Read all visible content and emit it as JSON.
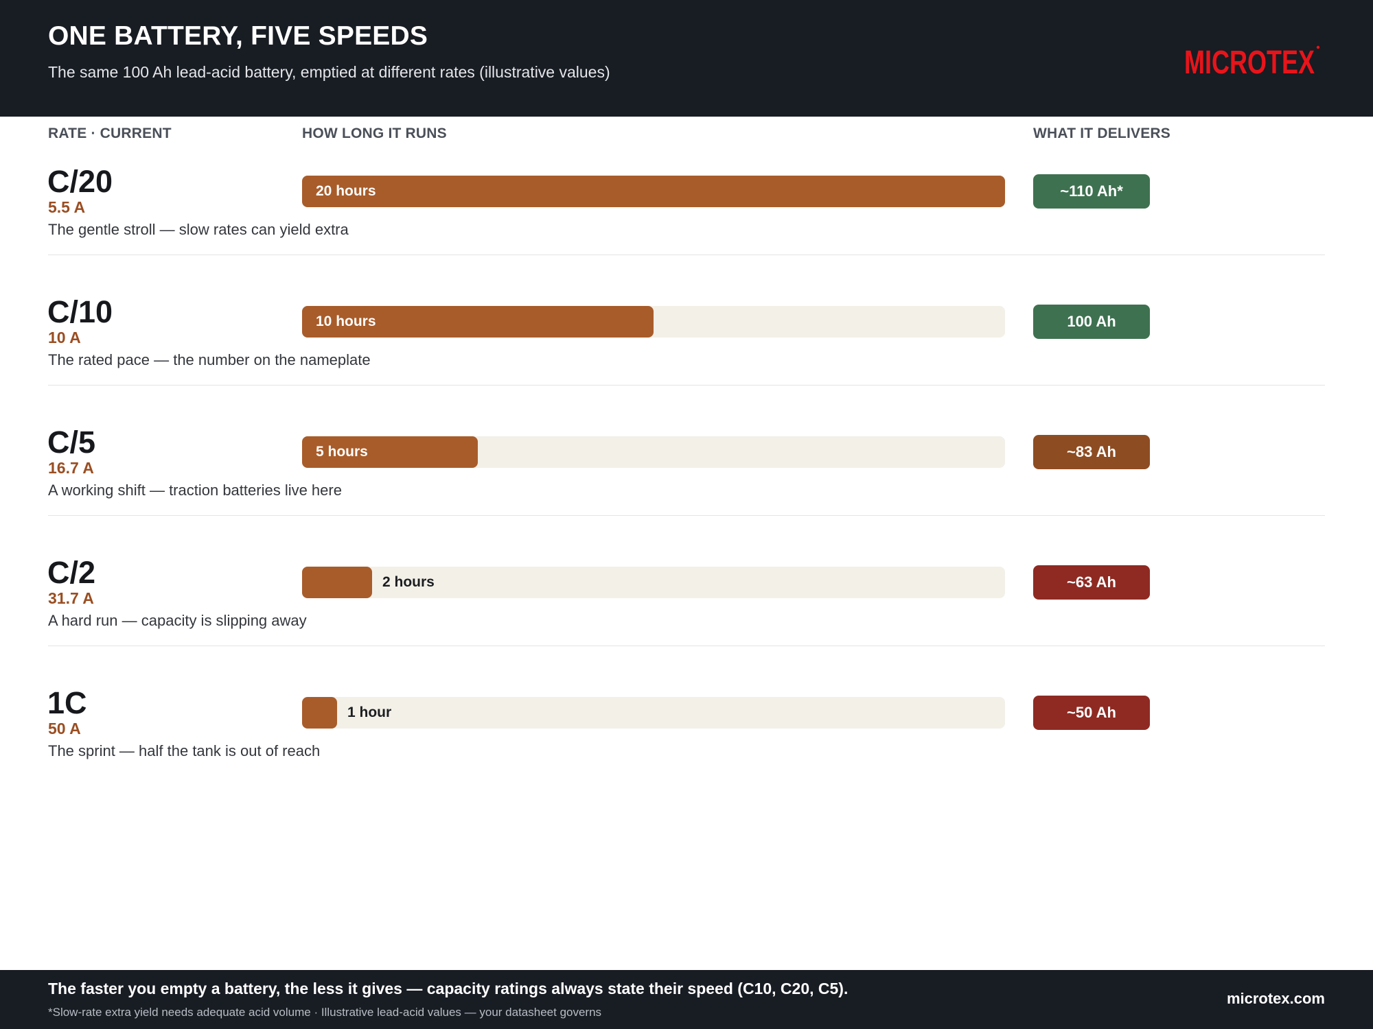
{
  "header": {
    "title": "ONE BATTERY, FIVE SPEEDS",
    "subtitle": "The same 100 Ah lead-acid battery, emptied at different rates (illustrative values)",
    "logo_text": "MICROTEX"
  },
  "columns": {
    "rate": "RATE · CURRENT",
    "runtime": "HOW LONG IT RUNS",
    "delivers": "WHAT IT DELIVERS"
  },
  "colors": {
    "bar": "#a85c2a",
    "track": "#f3f0e8",
    "good": "#3e7150",
    "warn": "#8e4c22",
    "bad": "#8e2a22",
    "logo": "#e8141a"
  },
  "chart_data": {
    "type": "bar",
    "title": "ONE BATTERY, FIVE SPEEDS",
    "xlim": [
      0,
      20
    ],
    "categories": [
      "C/20",
      "C/10",
      "C/5",
      "C/2",
      "1C"
    ],
    "rows": [
      {
        "rate": "C/20",
        "current": "5.5 A",
        "description": "The gentle stroll — slow rates can yield extra",
        "hours": 20,
        "runtime_label": "20 hours",
        "delivers": "~110 Ah*",
        "delivers_ah": 110,
        "status": "good"
      },
      {
        "rate": "C/10",
        "current": "10 A",
        "description": "The rated pace — the number on the nameplate",
        "hours": 10,
        "runtime_label": "10 hours",
        "delivers": "100 Ah",
        "delivers_ah": 100,
        "status": "good"
      },
      {
        "rate": "C/5",
        "current": "16.7 A",
        "description": "A working shift — traction batteries live here",
        "hours": 5,
        "runtime_label": "5 hours",
        "delivers": "~83 Ah",
        "delivers_ah": 83,
        "status": "warn"
      },
      {
        "rate": "C/2",
        "current": "31.7 A",
        "description": "A hard run — capacity is slipping away",
        "hours": 2,
        "runtime_label": "2 hours",
        "delivers": "~63 Ah",
        "delivers_ah": 63,
        "status": "bad"
      },
      {
        "rate": "1C",
        "current": "50 A",
        "description": "The sprint — half the tank is out of reach",
        "hours": 1,
        "runtime_label": "1 hour",
        "delivers": "~50 Ah",
        "delivers_ah": 50,
        "status": "bad"
      }
    ]
  },
  "footer": {
    "takeaway": "The faster you empty a battery, the less it gives — capacity ratings always state their speed (C10, C20, C5).",
    "footnote": "*Slow-rate extra yield needs adequate acid volume · Illustrative lead-acid values — your datasheet governs",
    "website": "microtex.com"
  }
}
